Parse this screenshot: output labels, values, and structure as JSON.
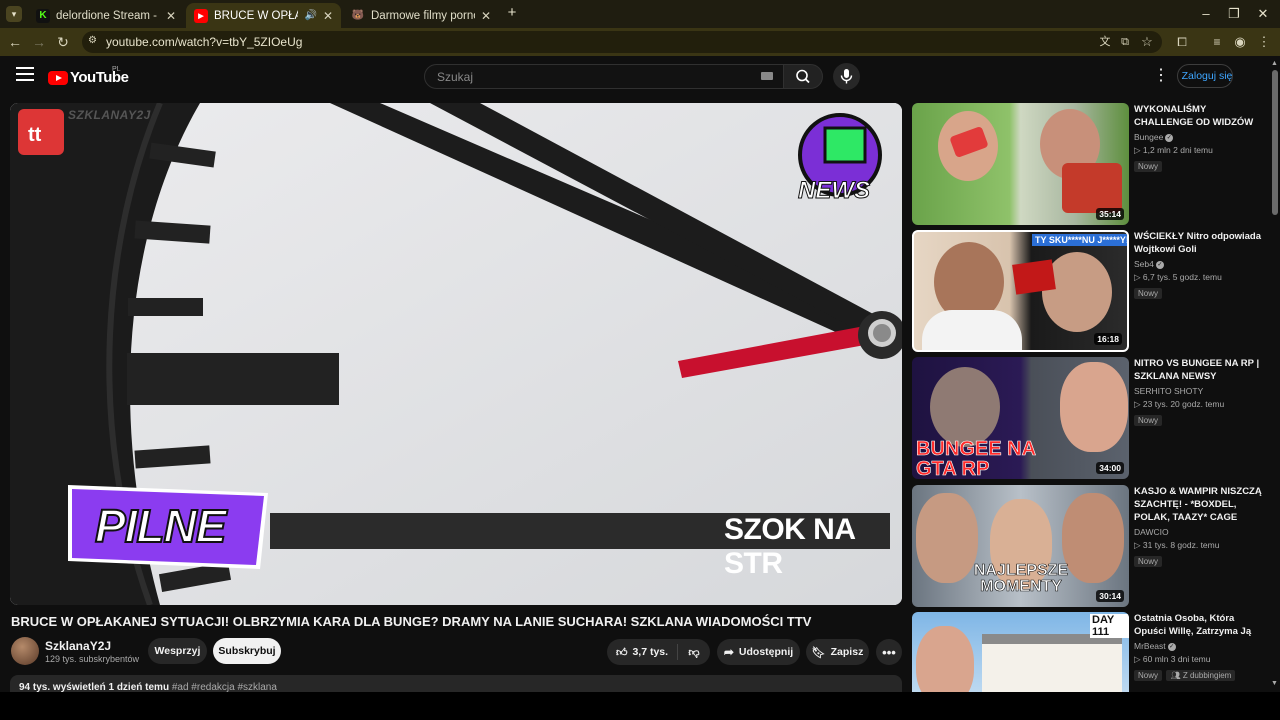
{
  "browser": {
    "tabs": [
      {
        "title": "delordione Stream - Watch Live",
        "favicon": "K",
        "favicon_color": "#53fc18"
      },
      {
        "title": "BRUCE W OPŁAKANEJ SYTUACJ",
        "favicon": "▶",
        "favicon_color": "#ff0000"
      },
      {
        "title": "Darmowe filmy porno, popular",
        "favicon": "🐻",
        "favicon_color": "#3a3514"
      }
    ],
    "url": "youtube.com/watch?v=tbY_5ZIOeUg",
    "accent": "#3a3514"
  },
  "header": {
    "logo_text": "YouTube",
    "region": "PL",
    "search_placeholder": "Szukaj",
    "signin_label": "Zaloguj się"
  },
  "video": {
    "watermark": "SZKLANAY2J",
    "overlay_pilne": "PILNE",
    "overlay_ticker": "SZOK NA STR",
    "overlay_news": "NEWS",
    "title": "BRUCE W OPŁAKANEJ SYTUACJI! OLBRZYMIA KARA DLA BUNGE? DRAMY NA LANIE SUCHARA! SZKLANA WIADOMOŚCI TTV",
    "channel": "SzklanaY2J",
    "subscribers": "129 tys. subskrybentów",
    "support_label": "Wesprzyj",
    "subscribe_label": "Subskrybuj",
    "likes": "3,7 tys.",
    "share_label": "Udostępnij",
    "save_label": "Zapisz",
    "views_date": "94 tys. wyświetleń  1 dzień temu",
    "tags": "#ad #redakcja #szklana"
  },
  "sidebar": {
    "items": [
      {
        "title": "WYKONALIŚMY CHALLENGE OD WIDZÓW",
        "channel": "Bungee",
        "verified": true,
        "views": "1,2 mln",
        "age": "2 dni temu",
        "badge": "Nowy",
        "duration": "35:14",
        "thumb_text": ""
      },
      {
        "title": "WŚCIEKŁY Nitro odpowiada Wojtkowi Goli",
        "channel": "Seb4",
        "verified": true,
        "views": "6,7 tys.",
        "age": "5 godz. temu",
        "badge": "Nowy",
        "duration": "16:18",
        "thumb_text": "TY SKU****NU J*****Y!"
      },
      {
        "title": "NITRO VS BUNGEE NA RP | SZKLANA NEWSY",
        "channel": "SERHITO SHOTY",
        "verified": false,
        "views": "23 tys.",
        "age": "20 godz. temu",
        "badge": "Nowy",
        "duration": "34:00",
        "thumb_text": "BUNGEE NA GTA RP"
      },
      {
        "title": "KASJO & WAMPIR NISZCZĄ SZACHTĘ! - *BOXDEL, POLAK, TAAZY* CAGE FAM...",
        "channel": "DAWCIO",
        "verified": false,
        "views": "31 tys.",
        "age": "8 godz. temu",
        "badge": "Nowy",
        "duration": "30:14",
        "thumb_text": "NAJLEPSZE MOMENTY"
      },
      {
        "title": "Ostatnia Osoba, Która Opuści Willę, Zatrzyma Ją",
        "channel": "MrBeast",
        "verified": true,
        "views": "60 mln",
        "age": "3 dni temu",
        "badge": "Nowy",
        "badge2": "Z dubbingiem",
        "duration": "",
        "thumb_text": "DAY 111"
      }
    ]
  }
}
